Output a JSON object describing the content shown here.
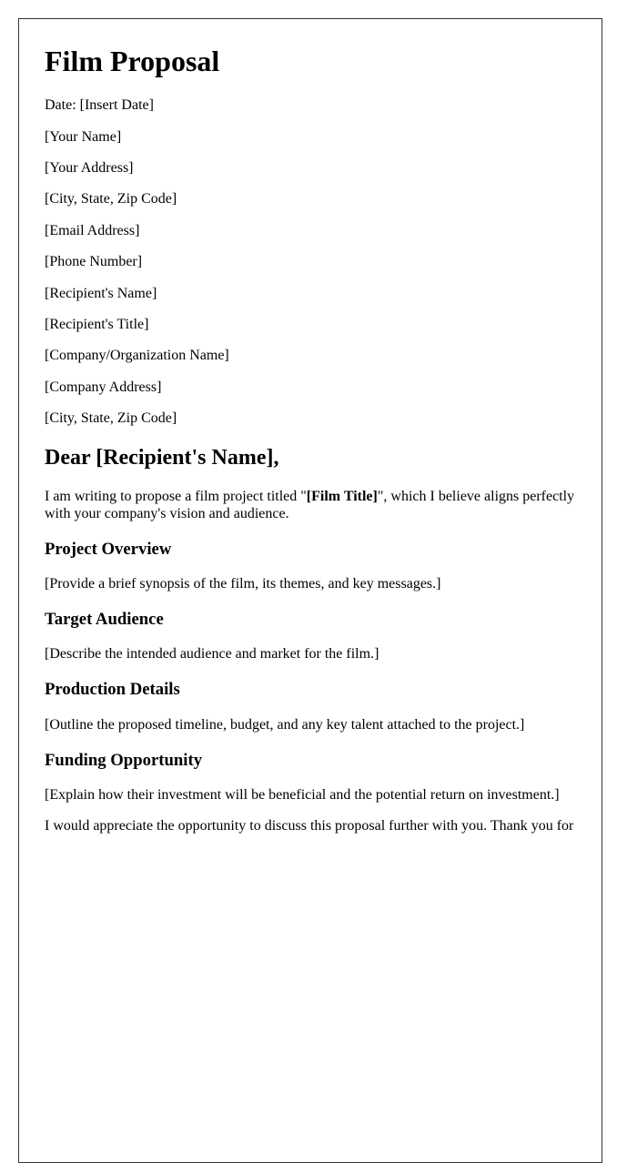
{
  "document": {
    "title": "Film Proposal",
    "sender_block": [
      "Date: [Insert Date]",
      "[Your Name]",
      "[Your Address]",
      "[City, State, Zip Code]",
      "[Email Address]",
      "[Phone Number]"
    ],
    "recipient_block": [
      "[Recipient's Name]",
      "[Recipient's Title]",
      "[Company/Organization Name]",
      "[Company Address]",
      "[City, State, Zip Code]"
    ],
    "salutation": "Dear [Recipient's Name],",
    "intro": {
      "before": "I am writing to propose a film project titled \"",
      "film_title": "[Film Title]",
      "after": "\", which I believe aligns perfectly with your company's vision and audience."
    },
    "sections": [
      {
        "heading": "Project Overview",
        "body": "[Provide a brief synopsis of the film, its themes, and key messages.]"
      },
      {
        "heading": "Target Audience",
        "body": "[Describe the intended audience and market for the film.]"
      },
      {
        "heading": "Production Details",
        "body": "[Outline the proposed timeline, budget, and any key talent attached to the project.]"
      },
      {
        "heading": "Funding Opportunity",
        "body": "[Explain how their investment will be beneficial and the potential return on investment.]"
      }
    ],
    "closing_partial": "I would appreciate the opportunity to discuss this proposal further with you. Thank you for"
  }
}
